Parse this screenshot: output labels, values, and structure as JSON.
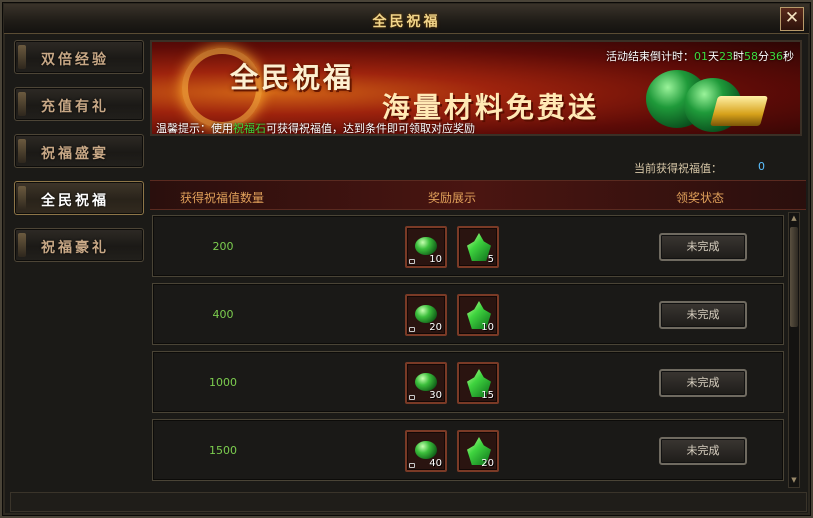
{
  "window": {
    "title": "全民祝福",
    "close_label": "✕"
  },
  "sidebar": {
    "items": [
      {
        "label": "双倍经验",
        "active": false
      },
      {
        "label": "充值有礼",
        "active": false
      },
      {
        "label": "祝福盛宴",
        "active": false
      },
      {
        "label": "全民祝福",
        "active": true
      },
      {
        "label": "祝福豪礼",
        "active": false
      }
    ]
  },
  "banner": {
    "title": "全民祝福",
    "subtitle": "海量材料免费送",
    "countdown": {
      "prefix": "活动结束倒计时：",
      "days": "01",
      "days_unit": "天",
      "hours": "23",
      "hours_unit": "时",
      "minutes": "58",
      "minutes_unit": "分",
      "seconds": "36",
      "seconds_unit": "秒"
    },
    "tip": {
      "prefix": "温馨提示：使用",
      "highlight": "祝福石",
      "suffix": "可获得祝福值，达到条件即可领取对应奖励"
    }
  },
  "current_wish": {
    "label": "当前获得祝福值：",
    "value": "0"
  },
  "table": {
    "headers": [
      "获得祝福值数量",
      "奖励展示",
      "领奖状态"
    ],
    "rows": [
      {
        "amount": "200",
        "gem_count": "10",
        "crystal_count": "5",
        "status": "未完成"
      },
      {
        "amount": "400",
        "gem_count": "20",
        "crystal_count": "10",
        "status": "未完成"
      },
      {
        "amount": "1000",
        "gem_count": "30",
        "crystal_count": "15",
        "status": "未完成"
      },
      {
        "amount": "1500",
        "gem_count": "40",
        "crystal_count": "20",
        "status": "未完成"
      }
    ]
  },
  "icons": {
    "gem": "green-gem-icon",
    "crystal": "green-crystal-icon",
    "lock": "bound-lock-icon"
  },
  "colors": {
    "accent_gold": "#f2d58a",
    "highlight_green": "#3fdc3f",
    "value_blue": "#5bc0ff",
    "header_orange": "#e0a05a"
  }
}
